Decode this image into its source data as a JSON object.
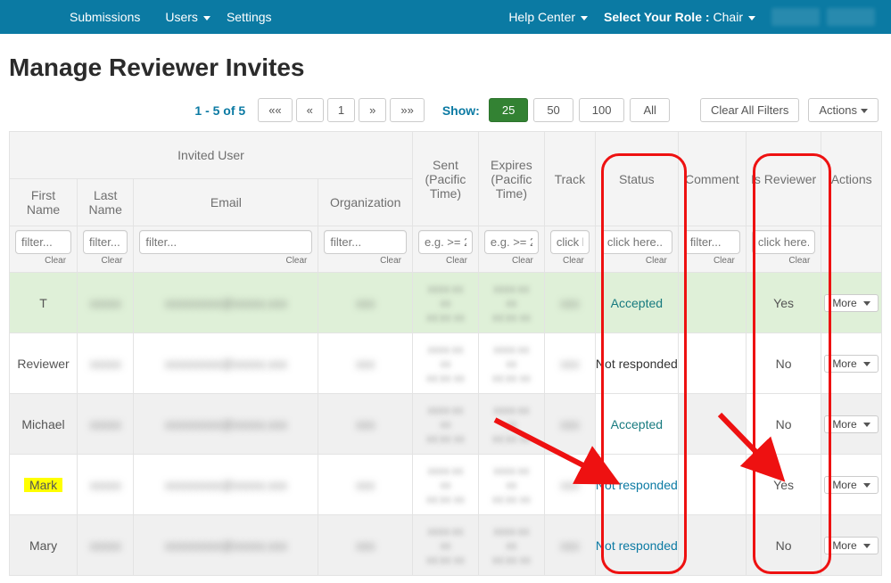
{
  "nav": {
    "submissions": "Submissions",
    "users": "Users",
    "settings": "Settings",
    "help_center": "Help Center",
    "select_role_label": "Select Your Role :",
    "chair": "Chair"
  },
  "page_title": "Manage Reviewer Invites",
  "pagination": {
    "range": "1 - 5 of 5",
    "first": "««",
    "prev": "«",
    "page": "1",
    "next": "»",
    "last": "»»"
  },
  "show": {
    "label": "Show:",
    "opt25": "25",
    "opt50": "50",
    "opt100": "100",
    "optAll": "All"
  },
  "buttons": {
    "clear_all": "Clear All Filters",
    "actions": "Actions",
    "more": "More"
  },
  "headers": {
    "invited_user": "Invited User",
    "first_name": "First Name",
    "last_name": "Last Name",
    "email": "Email",
    "organization": "Organization",
    "sent": "Sent (Pacific Time)",
    "expires": "Expires (Pacific Time)",
    "track": "Track",
    "status": "Status",
    "comment": "Comment",
    "is_reviewer": "Is Reviewer",
    "actions": "Actions"
  },
  "filters": {
    "text_ph": "filter...",
    "date_ph": "e.g. >= 2",
    "click_ph": "click here..",
    "click_ph_short": "click h",
    "click_ph_trunc": "click here.",
    "clear": "Clear"
  },
  "rows": [
    {
      "first": "T",
      "status": "Accepted",
      "status_class": "status-green",
      "is_reviewer": "Yes",
      "green": true,
      "highlight": false,
      "status_white": false,
      "isrev_white": false
    },
    {
      "first": "Reviewer",
      "status": "Not responded",
      "status_class": "status-dark",
      "is_reviewer": "No",
      "green": false,
      "highlight": false,
      "status_white": true,
      "isrev_white": true
    },
    {
      "first": "Michael",
      "status": "Accepted",
      "status_class": "status-green",
      "is_reviewer": "No",
      "green": false,
      "highlight": false,
      "status_white": true,
      "isrev_white": true
    },
    {
      "first": "Mark",
      "status": "Not responded",
      "status_class": "status-blue",
      "is_reviewer": "Yes",
      "green": false,
      "highlight": true,
      "status_white": true,
      "isrev_white": true
    },
    {
      "first": "Mary",
      "status": "Not responded",
      "status_class": "status-blue",
      "is_reviewer": "No",
      "green": false,
      "highlight": false,
      "status_white": false,
      "isrev_white": false
    }
  ]
}
